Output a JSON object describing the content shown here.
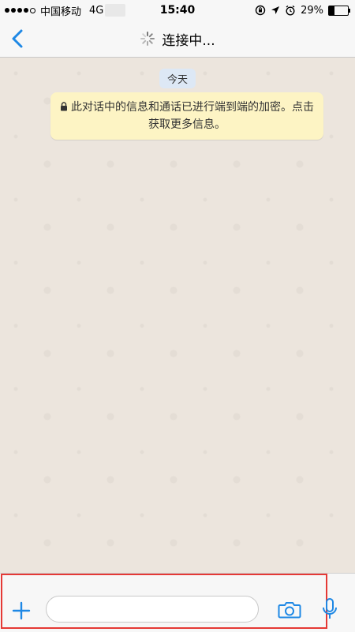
{
  "status_bar": {
    "carrier": "中国移动",
    "network": "4G",
    "time": "15:40",
    "battery": "29%",
    "battery_level": 0.29,
    "signal_filled": 4,
    "signal_total": 5
  },
  "nav": {
    "title": "连接中..."
  },
  "chat": {
    "date_label": "今天",
    "encryption_notice": "此对话中的信息和通话已进行端到端的加密。点击获取更多信息。"
  },
  "input": {
    "value": "",
    "placeholder": ""
  },
  "icons": {
    "back": "chevron-left-icon",
    "spinner": "loading-spinner-icon",
    "lock": "lock-icon",
    "plus": "plus-icon",
    "camera": "camera-icon",
    "mic": "microphone-icon"
  },
  "colors": {
    "accent": "#1e88e5",
    "notice_bg": "#fdf4c4",
    "date_bg": "#dde8f5",
    "chat_bg": "#ece5dd",
    "highlight": "#e53935"
  }
}
